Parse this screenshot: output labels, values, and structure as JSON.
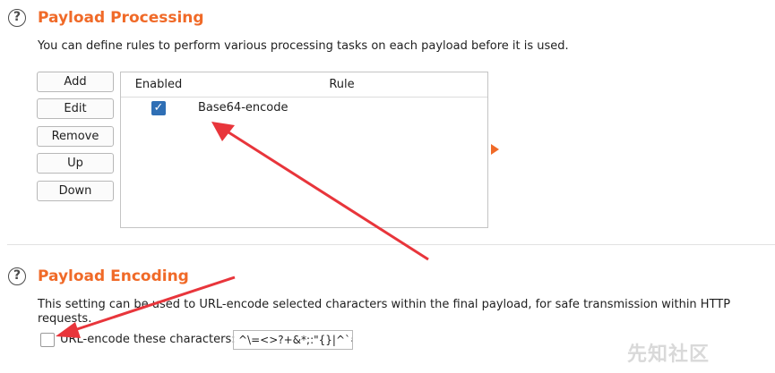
{
  "payload_processing": {
    "title": "Payload Processing",
    "description": "You can define rules to perform various processing tasks on each payload before it is used.",
    "buttons": {
      "add": "Add",
      "edit": "Edit",
      "remove": "Remove",
      "up": "Up",
      "down": "Down"
    },
    "table": {
      "columns": [
        "Enabled",
        "Rule"
      ],
      "rows": [
        {
          "enabled": true,
          "rule": "Base64-encode"
        }
      ]
    }
  },
  "payload_encoding": {
    "title": "Payload Encoding",
    "description": "This setting can be used to URL-encode selected characters within the final payload, for safe transmission within HTTP requests.",
    "checkbox_label": "URL-encode these characters:",
    "checkbox_checked": false,
    "characters": "^\\=<>?+&*;:\"{}|^`#"
  },
  "watermark": "先知社区",
  "colors": {
    "accent": "#f06a28",
    "checkbox": "#2f6fb5",
    "annotation_arrow": "#e8353b"
  },
  "icons": {
    "help": "question-circle-icon",
    "panel_toggle": "play-arrow-icon"
  }
}
